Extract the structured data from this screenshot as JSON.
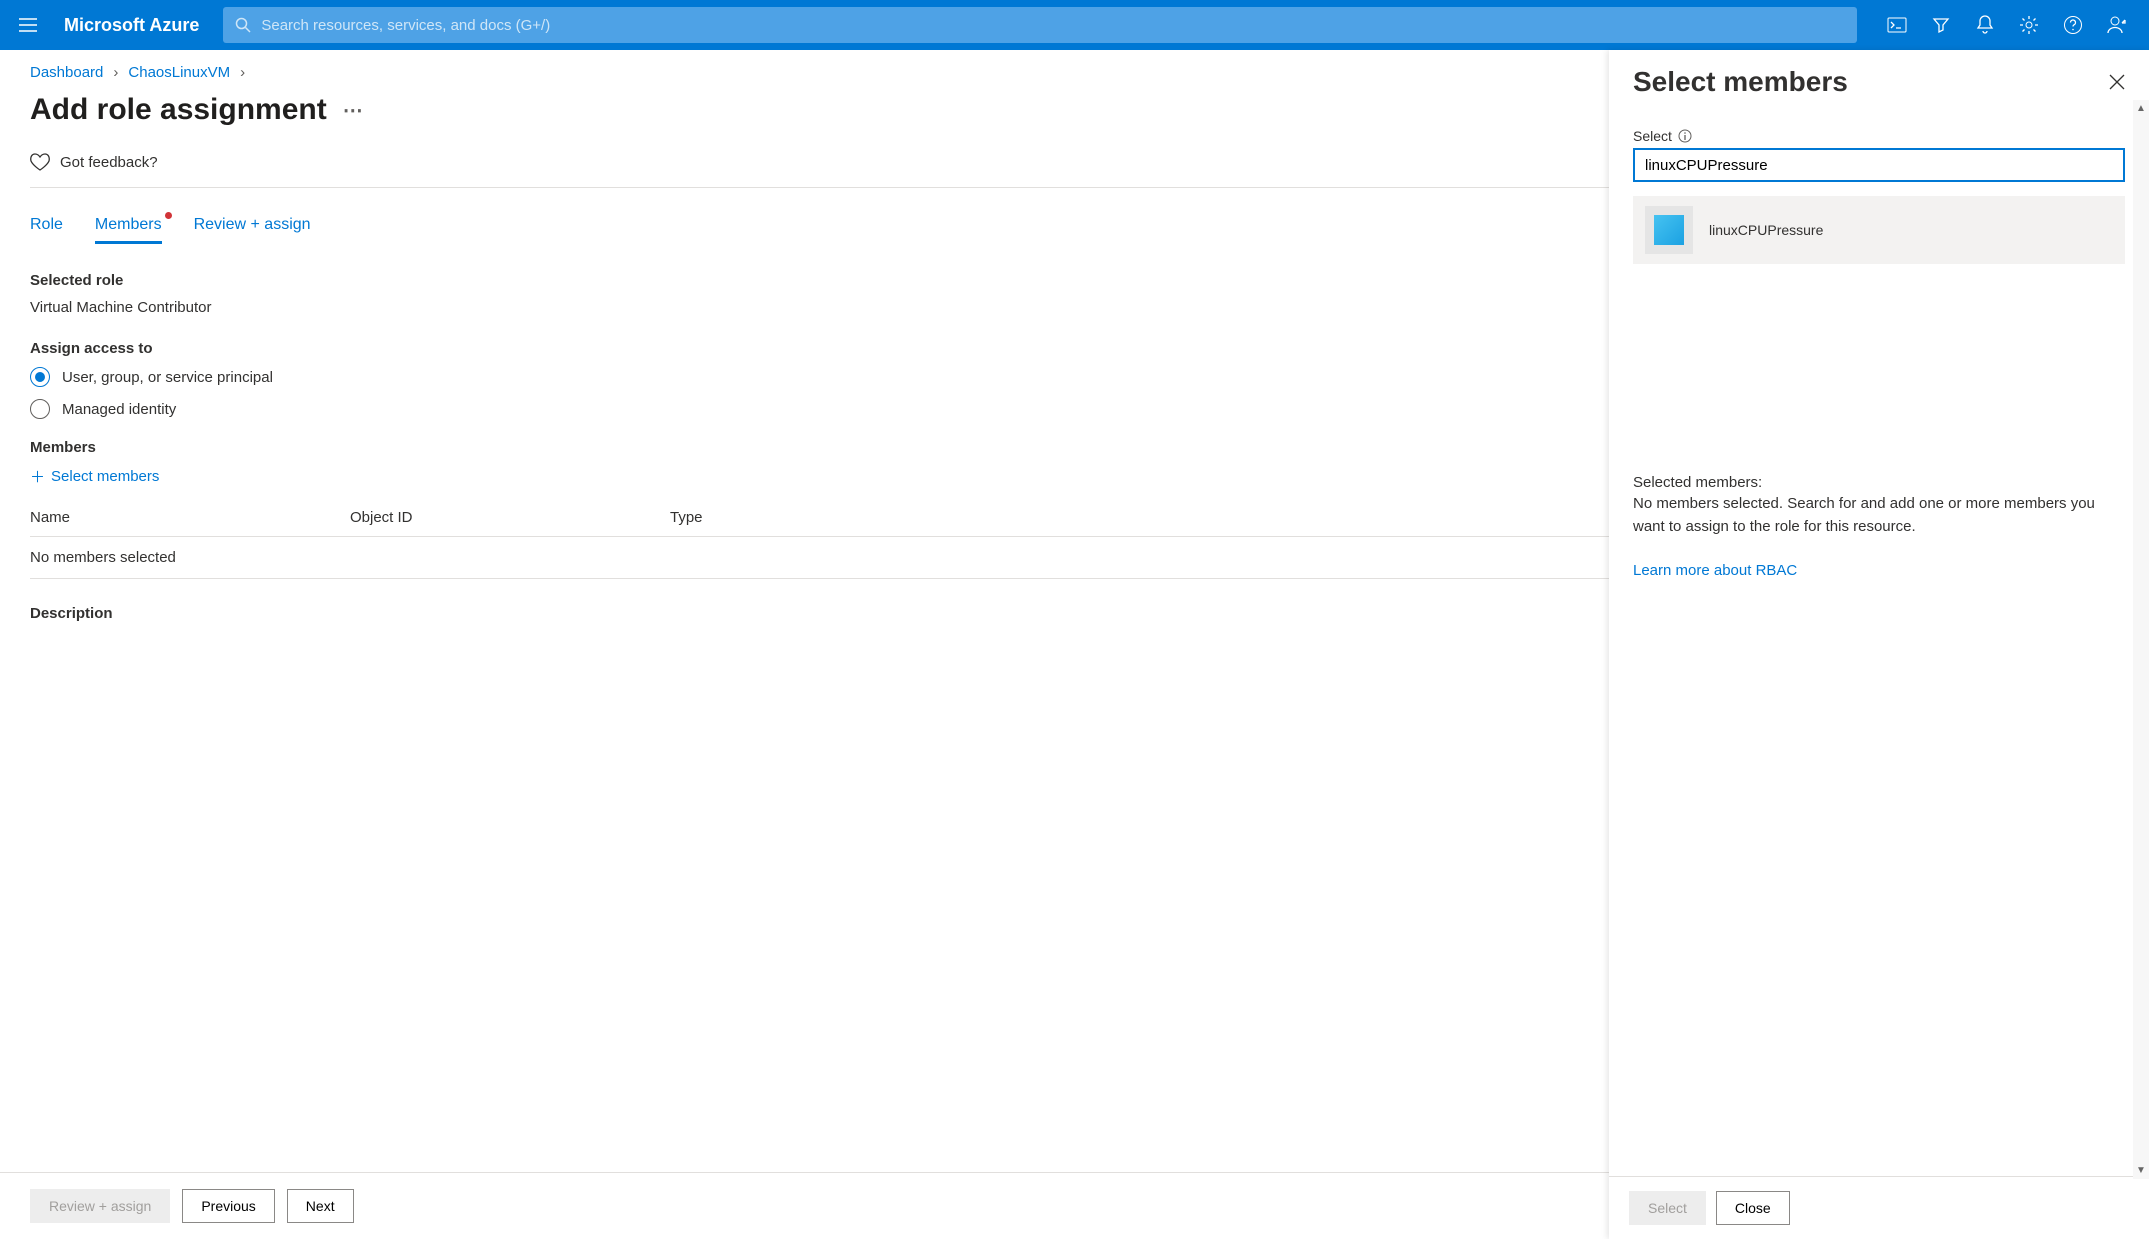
{
  "topbar": {
    "brand": "Microsoft Azure",
    "search_placeholder": "Search resources, services, and docs (G+/)"
  },
  "breadcrumb": {
    "items": [
      "Dashboard",
      "ChaosLinuxVM"
    ]
  },
  "page": {
    "title": "Add role assignment",
    "feedback": "Got feedback?"
  },
  "tabs": {
    "role": "Role",
    "members": "Members",
    "review": "Review + assign"
  },
  "selected_role": {
    "label": "Selected role",
    "value": "Virtual Machine Contributor"
  },
  "assign": {
    "label": "Assign access to",
    "opt1": "User, group, or service principal",
    "opt2": "Managed identity"
  },
  "members": {
    "label": "Members",
    "add": "Select members",
    "head_name": "Name",
    "head_obj": "Object ID",
    "head_type": "Type",
    "empty": "No members selected",
    "description": "Description"
  },
  "footer": {
    "review": "Review + assign",
    "previous": "Previous",
    "next": "Next"
  },
  "panel": {
    "title": "Select members",
    "select_label": "Select",
    "input_value": "linuxCPUPressure",
    "result_name": "linuxCPUPressure",
    "selected_title": "Selected members:",
    "selected_text": "No members selected. Search for and add one or more members you want to assign to the role for this resource.",
    "learn": "Learn more about RBAC",
    "btn_select": "Select",
    "btn_close": "Close"
  }
}
